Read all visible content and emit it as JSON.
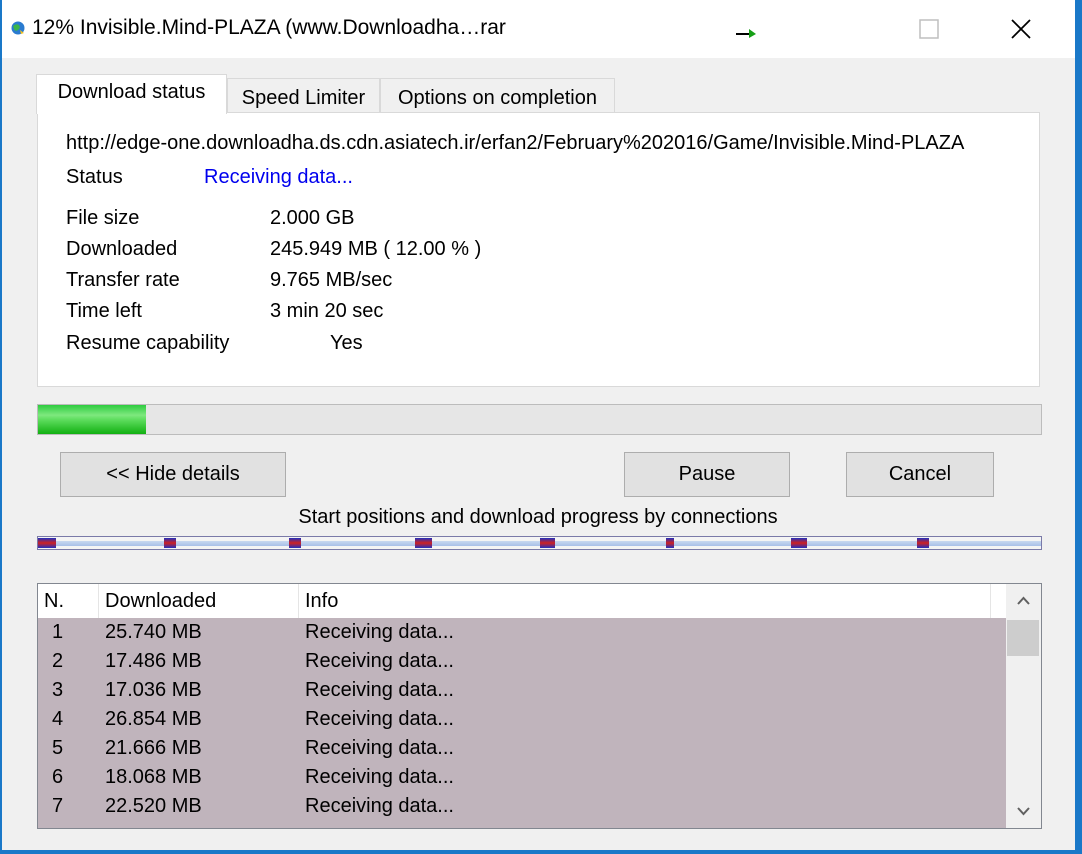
{
  "window": {
    "title": "12% Invisible.Mind-PLAZA (www.Downloadha…rar"
  },
  "tabs": [
    {
      "label": "Download status",
      "active": true
    },
    {
      "label": "Speed Limiter",
      "active": false
    },
    {
      "label": "Options on completion",
      "active": false
    }
  ],
  "details": {
    "url": "http://edge-one.downloadha.ds.cdn.asiatech.ir/erfan2/February%202016/Game/Invisible.Mind-PLAZA",
    "status_label": "Status",
    "status_value": "Receiving data...",
    "file_size_label": "File size",
    "file_size_value": "2.000  GB",
    "downloaded_label": "Downloaded",
    "downloaded_value": "245.949  MB  ( 12.00 % )",
    "transfer_rate_label": "Transfer rate",
    "transfer_rate_value": "9.765  MB/sec",
    "time_left_label": "Time left",
    "time_left_value": "3 min 20 sec",
    "resume_label": "Resume capability",
    "resume_value": "Yes"
  },
  "progress": {
    "fraction": 0.108,
    "color": "#2ecc40"
  },
  "buttons": {
    "hide_details": "<< Hide details",
    "pause": "Pause",
    "cancel": "Cancel"
  },
  "connections": {
    "title": "Start positions and download progress by connections"
  },
  "list": {
    "headers": [
      "N.",
      "Downloaded",
      "Info"
    ],
    "rows": [
      {
        "n": "1",
        "downloaded": "25.740  MB",
        "info": "Receiving data..."
      },
      {
        "n": "2",
        "downloaded": "17.486  MB",
        "info": "Receiving data..."
      },
      {
        "n": "3",
        "downloaded": "17.036  MB",
        "info": "Receiving data..."
      },
      {
        "n": "4",
        "downloaded": "26.854  MB",
        "info": "Receiving data..."
      },
      {
        "n": "5",
        "downloaded": "21.666  MB",
        "info": "Receiving data..."
      },
      {
        "n": "6",
        "downloaded": "18.068  MB",
        "info": "Receiving data..."
      },
      {
        "n": "7",
        "downloaded": "22.520  MB",
        "info": "Receiving data..."
      }
    ]
  },
  "colors": {
    "accent": "#1a78c8",
    "row_selected": "#c0b4bc",
    "status_link": "#0000ee"
  }
}
